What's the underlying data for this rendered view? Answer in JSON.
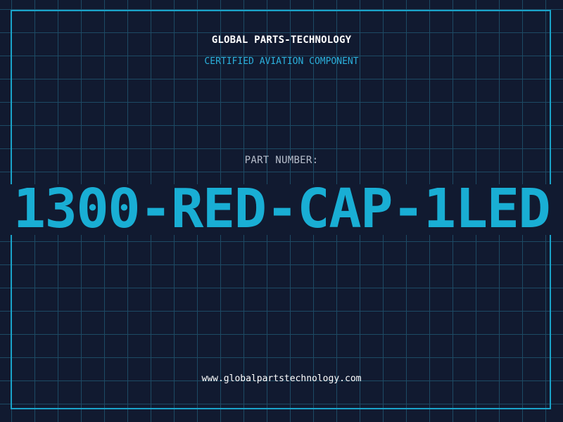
{
  "header": {
    "company": "GLOBAL PARTS-TECHNOLOGY",
    "subtitle": "CERTIFIED AVIATION COMPONENT"
  },
  "part": {
    "label": "PART NUMBER:",
    "number": "1300-RED-CAP-1LED"
  },
  "footer": {
    "website": "www.globalpartstechnology.com"
  },
  "colors": {
    "background": "#111a30",
    "grid": "#1d4a64",
    "accent": "#19aed4",
    "frame": "#1aa3c9"
  }
}
